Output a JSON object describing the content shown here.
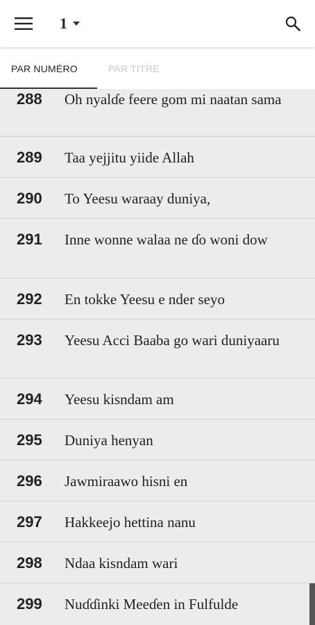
{
  "appbar": {
    "menu_icon": "hamburger-menu-icon",
    "book_number": "1",
    "dropdown_icon": "caret-down-icon",
    "search_icon": "search-icon"
  },
  "tabs": [
    {
      "label": "PAR NUMÉRO",
      "active": true
    },
    {
      "label": "PAR TITRE",
      "active": false
    }
  ],
  "hymns": [
    {
      "number": "288",
      "title": "Oh nyalɗe feere gom mi naatan sama"
    },
    {
      "number": "289",
      "title": "Taa yejjitu yiide Allah"
    },
    {
      "number": "290",
      "title": "To Yeesu waraay duniya,"
    },
    {
      "number": "291",
      "title": "Inne wonne walaa ne ɗo woni dow"
    },
    {
      "number": "292",
      "title": "En tokke Yeesu e nder seyo"
    },
    {
      "number": "293",
      "title": "Yeesu Acci Baaba go wari duniyaaru"
    },
    {
      "number": "294",
      "title": "Yeesu kisndam am"
    },
    {
      "number": "295",
      "title": "Duniya henyan"
    },
    {
      "number": "296",
      "title": "Jawmiraawo hisni en"
    },
    {
      "number": "297",
      "title": "Hakkeejo hettina nanu"
    },
    {
      "number": "298",
      "title": "Ndaa kisndam wari"
    },
    {
      "number": "299",
      "title": "Nuɗɗinki Meeɗen in Fulfulde"
    }
  ],
  "colors": {
    "list_background": "#ececec",
    "divider": "#d2d2d2",
    "active_tab_text": "#222222",
    "inactive_tab_text": "#c9c9c9"
  }
}
